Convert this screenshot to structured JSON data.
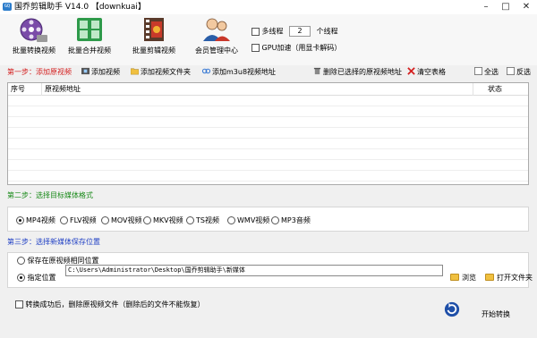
{
  "window": {
    "title": "国乔剪辑助手 V14.0 【downkuai】",
    "app_icon_text": "GQ",
    "minimize": "–",
    "maximize": "□",
    "close": "✕"
  },
  "toolbar": {
    "items": [
      {
        "label": "批量转换视频",
        "icon": "film-reel-icon"
      },
      {
        "label": "批量合并视频",
        "icon": "film-frames-icon"
      },
      {
        "label": "批量剪辑视频",
        "icon": "clapperboard-icon"
      },
      {
        "label": "会员管理中心",
        "icon": "users-icon"
      }
    ]
  },
  "options": {
    "multithread_label": "多线程",
    "thread_count": "2",
    "thread_unit": "个线程",
    "gpu_label": "GPU加速（用显卡解码）"
  },
  "step1": {
    "title": "第一步：添加原视频",
    "actions": {
      "add_video": "添加视频",
      "add_folder": "添加视频文件夹",
      "add_m3u8": "添加m3u8视频地址",
      "delete_selected": "删除已选择的原视频地址",
      "clear_table": "清空表格",
      "select_all": "全选",
      "invert": "反选"
    },
    "table": {
      "columns": [
        "序号",
        "原视频地址",
        "状态"
      ]
    }
  },
  "step2": {
    "title": "第二步：选择目标媒体格式",
    "formats": [
      "MP4视频",
      "FLV视频",
      "MOV视频",
      "MKV视频",
      "TS视频",
      "WMV视频",
      "MP3音频"
    ],
    "selected": "MP4视频"
  },
  "step3": {
    "title": "第三步：选择新媒体保存位置",
    "same_location_label": "保存在原视频相同位置",
    "custom_location_label": "指定位置",
    "path": "C:\\Users\\Administrator\\Desktop\\国乔剪辑助手\\新媒体",
    "browse_label": "浏览",
    "open_folder_label": "打开文件夹"
  },
  "footer": {
    "delete_after_label": "转换成功后，删除原视频文件（删除后的文件不能恢复）",
    "start_label": "开始转换"
  },
  "colors": {
    "step1_title": "#d42020",
    "step2_title": "#1a8a1a",
    "step3_title": "#1f3fc4"
  }
}
